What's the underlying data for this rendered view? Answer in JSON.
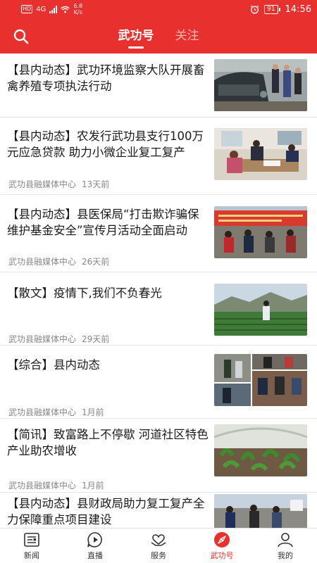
{
  "status_bar": {
    "hd": "HD",
    "network": "4G",
    "speed_value": "6.8",
    "speed_unit": "K/s",
    "alarm_icon": "alarm-icon",
    "battery": "91",
    "time": "14:56"
  },
  "header": {
    "search_icon": "search-icon",
    "tabs": [
      {
        "label": "武功号",
        "active": true
      },
      {
        "label": "关注",
        "active": false
      }
    ]
  },
  "feed": [
    {
      "title": "【县内动态】武功环境监察大队开展畜禽养殖专项执法行动",
      "source": "",
      "time": "",
      "image": "photo of officers beside a car"
    },
    {
      "title": "【县内动态】农发行武功县支行100万元应急贷款 助力小微企业复工复产",
      "source": "武功县融媒体中心",
      "time": "13天前",
      "image": "photo of staff at a desk"
    },
    {
      "title": "【县内动态】县医保局“打击欺诈骗保 维护基金安全”宣传月活动全面启动",
      "source": "武功县融媒体中心",
      "time": "26天前",
      "image": "photo of outdoor campaign event with red banner"
    },
    {
      "title": "【散文】疫情下,我们不负春光",
      "source": "武功县融媒体中心",
      "time": "29天前",
      "image": "photo of woman in a tea field"
    },
    {
      "title": "【综合】县内动态",
      "source": "武功县融媒体中心",
      "time": "1月前",
      "image": "collage of four photos"
    },
    {
      "title": "【简讯】致富路上不停歇 河道社区特色产业助农增收",
      "source": "武功县融媒体中心",
      "time": "1月前",
      "image": "photo of seedlings in a greenhouse"
    },
    {
      "title": "【县内动态】县财政局助力复工复产全力保障重点项目建设",
      "source": "",
      "time": "",
      "image": "photo of people at a project site"
    }
  ],
  "bottom_nav": [
    {
      "label": "新闻",
      "icon": "news-icon",
      "active": false
    },
    {
      "label": "直播",
      "icon": "live-icon",
      "active": false
    },
    {
      "label": "服务",
      "icon": "service-icon",
      "active": false
    },
    {
      "label": "武功号",
      "icon": "compass-icon",
      "active": true
    },
    {
      "label": "我的",
      "icon": "profile-icon",
      "active": false
    }
  ],
  "colors": {
    "brand_red": "#e8312f",
    "text": "#1a1a1a",
    "meta": "#888888"
  }
}
